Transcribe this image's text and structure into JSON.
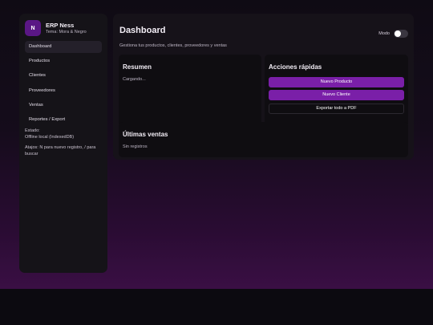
{
  "sidebar": {
    "logo_letter": "N",
    "app_name": "ERP Ness",
    "theme_label": "Tema: Mora & Negro",
    "items": [
      {
        "label": "Dashboard"
      },
      {
        "label": "Productos"
      },
      {
        "label": "Clientes"
      },
      {
        "label": "Proveedores"
      },
      {
        "label": "Ventas"
      },
      {
        "label": "Reportes / Export"
      }
    ],
    "status_label": "Estado:",
    "status_value": "Offline local (IndexedDB)",
    "shortcuts": "Atajos: N para nuevo registro, / para buscar"
  },
  "header": {
    "title": "Dashboard",
    "subtitle": "Gestiona tus productos, clientes, proveedores y ventas",
    "mode_label": "Modo"
  },
  "summary": {
    "title": "Resumen",
    "loading": "Cargando..."
  },
  "actions": {
    "title": "Acciones rápidas",
    "new_product": "Nuevo Producto",
    "new_client": "Nuevo Cliente",
    "export_pdf": "Exportar todo a PDF"
  },
  "sales": {
    "title": "Últimas ventas",
    "empty": "Sin registros"
  },
  "colors": {
    "accent": "#7a1fa8",
    "logo_bg": "#5a1785",
    "panel": "#151318",
    "card": "#0f0d11"
  }
}
